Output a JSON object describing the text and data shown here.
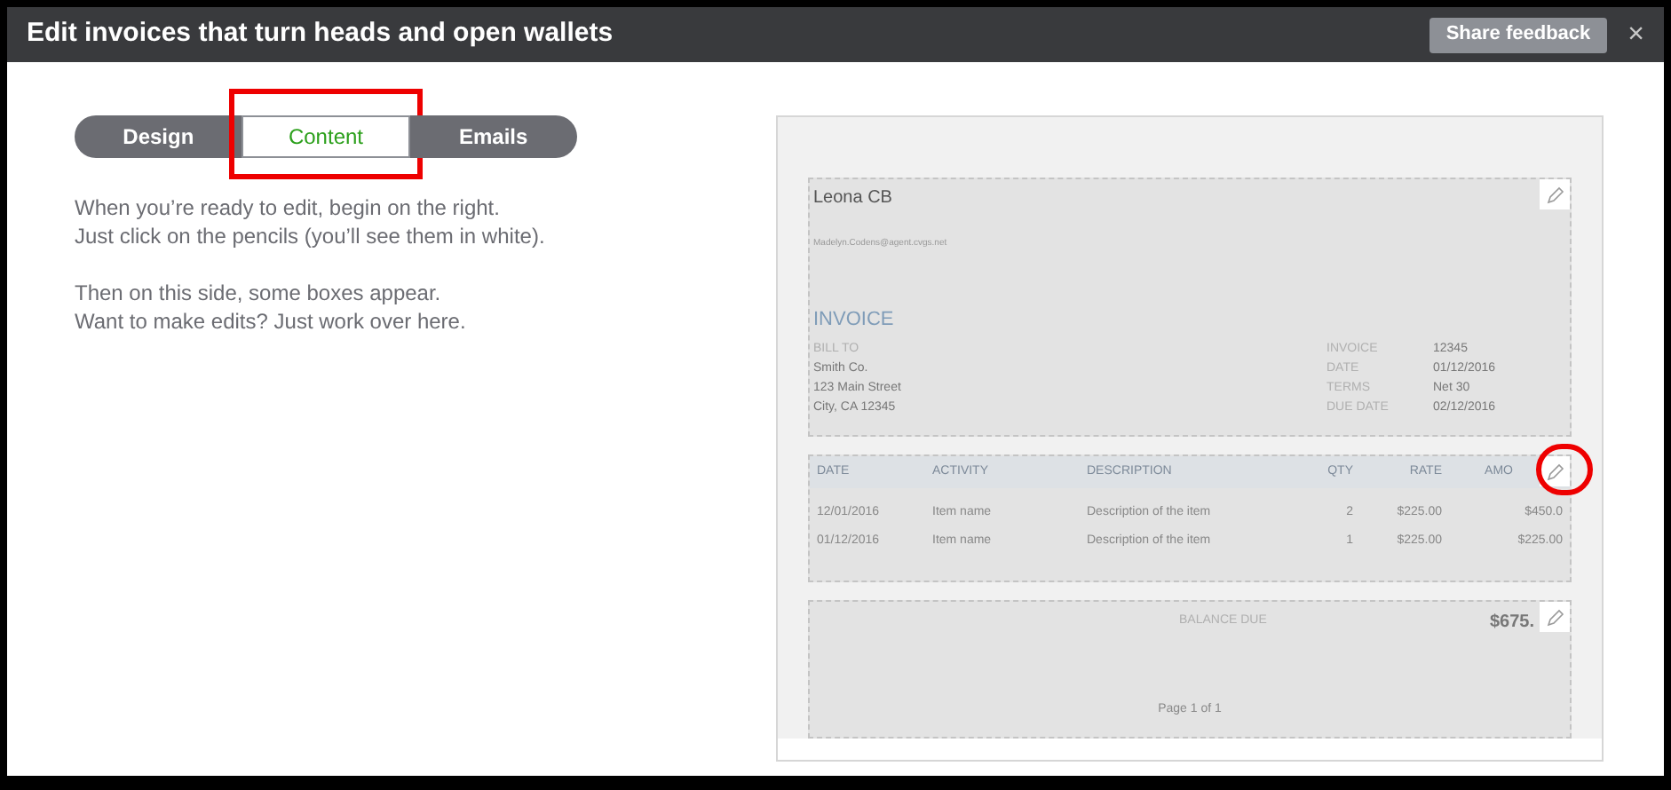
{
  "window": {
    "title": "Edit invoices that turn heads and open wallets",
    "feedback_button": "Share feedback",
    "close": "×"
  },
  "tabs": [
    {
      "label": "Design",
      "selected": false,
      "highlighted": false
    },
    {
      "label": "Content",
      "selected": true,
      "highlighted": true
    },
    {
      "label": "Emails",
      "selected": false,
      "highlighted": false
    }
  ],
  "instructions": [
    "When you’re ready to edit, begin on the right.\nJust click on the pencils (you’ll see them in white).",
    "Then on this side, some boxes appear.\nWant to make edits? Just work over here."
  ],
  "preview": {
    "header": {
      "company": "Leona CB",
      "email": "Madelyn.Codens@agent.cvgs.net",
      "doc_title": "INVOICE",
      "bill_to_label": "BILL TO",
      "bill_to": [
        "Smith Co.",
        "123 Main Street",
        "City, CA 12345"
      ],
      "details": [
        {
          "label": "INVOICE",
          "value": "12345"
        },
        {
          "label": "DATE",
          "value": "01/12/2016"
        },
        {
          "label": "TERMS",
          "value": "Net 30"
        },
        {
          "label": "DUE DATE",
          "value": "02/12/2016"
        }
      ],
      "pencil_highlighted": false
    },
    "table": {
      "columns": [
        "DATE",
        "ACTIVITY",
        "DESCRIPTION",
        "QTY",
        "RATE",
        "AMO"
      ],
      "rows": [
        [
          "12/01/2016",
          "Item name",
          "Description of the item",
          "2",
          "$225.00",
          "$450.0"
        ],
        [
          "01/12/2016",
          "Item name",
          "Description of the item",
          "1",
          "$225.00",
          "$225.00"
        ]
      ],
      "pencil_highlighted": true
    },
    "footer": {
      "balance_label": "BALANCE DUE",
      "balance": "$675.",
      "page": "Page 1 of 1",
      "pencil_highlighted": false
    }
  }
}
